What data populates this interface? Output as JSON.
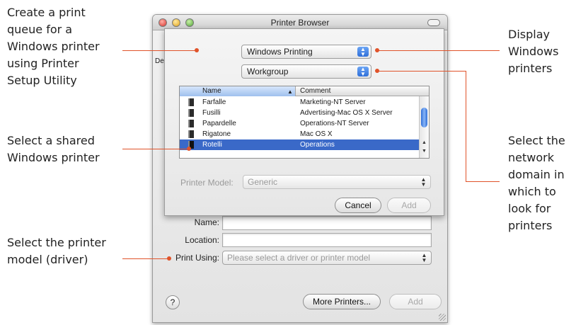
{
  "callouts": {
    "create_queue": [
      "Create a print",
      "queue for a",
      "Windows printer",
      "using Printer",
      "Setup Utility"
    ],
    "select_shared": [
      "Select a shared",
      "Windows printer"
    ],
    "select_model": [
      "Select the printer",
      "model (driver)"
    ],
    "display_windows": [
      "Display",
      "Windows",
      "printers"
    ],
    "select_domain": [
      "Select the",
      "network",
      "domain in",
      "which to",
      "look for",
      "printers"
    ]
  },
  "window": {
    "title": "Printer Browser",
    "fragment_left": "De",
    "name_label": "Name:",
    "location_label": "Location:",
    "location_value": "",
    "print_using_label": "Print Using:",
    "print_using_placeholder": "Please select a driver or printer model",
    "help_label": "?",
    "more_printers_label": "More Printers...",
    "add_label": "Add"
  },
  "sheet": {
    "connection_type": "Windows Printing",
    "domain": "Workgroup",
    "list_headers": {
      "name": "Name",
      "comment": "Comment"
    },
    "rows": [
      {
        "name": "Farfalle",
        "comment": "Marketing-NT Server",
        "selected": false
      },
      {
        "name": "Fusilli",
        "comment": "Advertising-Mac OS X Server",
        "selected": false
      },
      {
        "name": "Papardelle",
        "comment": "Operations-NT Server",
        "selected": false
      },
      {
        "name": "Rigatone",
        "comment": "Mac OS X",
        "selected": false
      },
      {
        "name": "Rotelli",
        "comment": "Operations",
        "selected": true
      }
    ],
    "model_label": "Printer Model:",
    "model_value": "Generic",
    "cancel_label": "Cancel",
    "add_label": "Add"
  },
  "colors": {
    "leader_line": "#e0532a",
    "selection": "#3a69c8",
    "popup_accent": "#2f6fd9"
  }
}
